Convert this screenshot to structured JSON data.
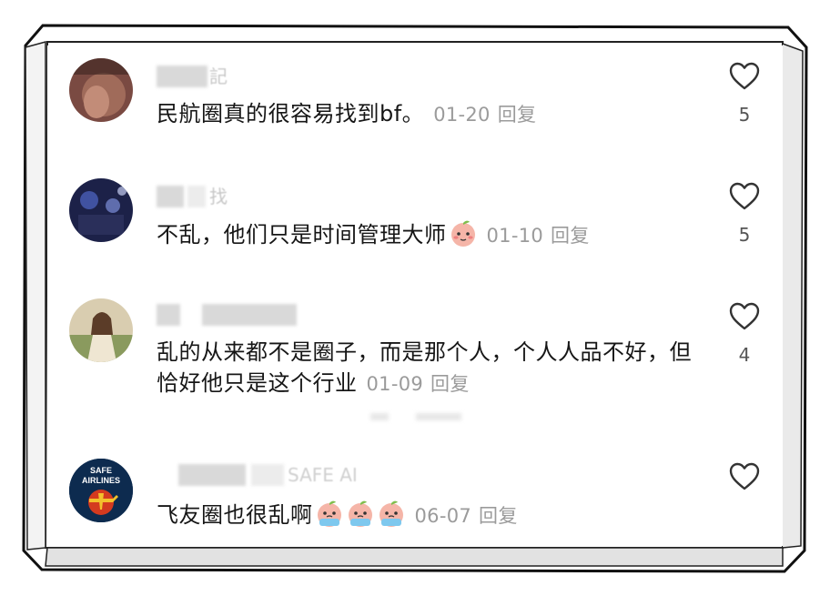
{
  "comments": [
    {
      "username_tail": "記",
      "text": "民航圈真的很容易找到bf。",
      "date": "01-20",
      "reply": "回复",
      "likes": "5",
      "avatar_icon": "user-avatar-photo"
    },
    {
      "username_tail": "找",
      "text": "不乱，他们只是时间管理大师",
      "date": "01-10",
      "reply": "回复",
      "likes": "5",
      "avatar_icon": "user-avatar-photo"
    },
    {
      "username_tail": "",
      "text": "乱的从来都不是圈子，而是那个人，个人人品不好，但恰好他只是这个行业",
      "date": "01-09",
      "reply": "回复",
      "likes": "4",
      "avatar_icon": "user-avatar-photo"
    },
    {
      "username_tail": "SAFE AI",
      "text": "飞友圈也很乱啊",
      "date": "06-07",
      "reply": "回复",
      "likes": "",
      "avatar_icon": "safe-airlines-logo",
      "avatar_logo_text": [
        "SAFE",
        "AIRLINES"
      ]
    }
  ],
  "icons": {
    "like": "heart-outline-icon",
    "emoji": "peach-face-emoji"
  },
  "colors": {
    "text": "#161616",
    "meta": "#9b9b9b",
    "frame": "#111111"
  }
}
